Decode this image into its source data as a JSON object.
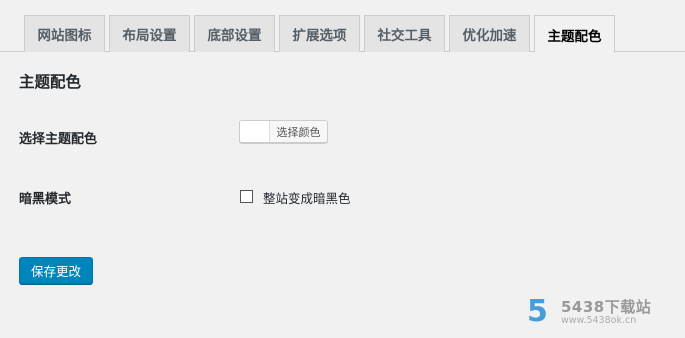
{
  "tabs": [
    {
      "label": "网站图标",
      "active": false
    },
    {
      "label": "布局设置",
      "active": false
    },
    {
      "label": "底部设置",
      "active": false
    },
    {
      "label": "扩展选项",
      "active": false
    },
    {
      "label": "社交工具",
      "active": false
    },
    {
      "label": "优化加速",
      "active": false
    },
    {
      "label": "主题配色",
      "active": true
    }
  ],
  "section": {
    "title": "主题配色"
  },
  "theme_color": {
    "label": "选择主题配色",
    "button_text": "选择颜色",
    "value": "#ffffff"
  },
  "dark_mode": {
    "label": "暗黑模式",
    "checkbox_label": "整站变成暗黑色",
    "checked": false
  },
  "save_button": {
    "label": "保存更改"
  },
  "watermark": {
    "logo": "5",
    "name": "5438下载站",
    "url": "www.5438ok.cn"
  },
  "colors": {
    "primary": "#0085ba",
    "background": "#f1f1f1",
    "tab_inactive": "#e4e4e4"
  }
}
